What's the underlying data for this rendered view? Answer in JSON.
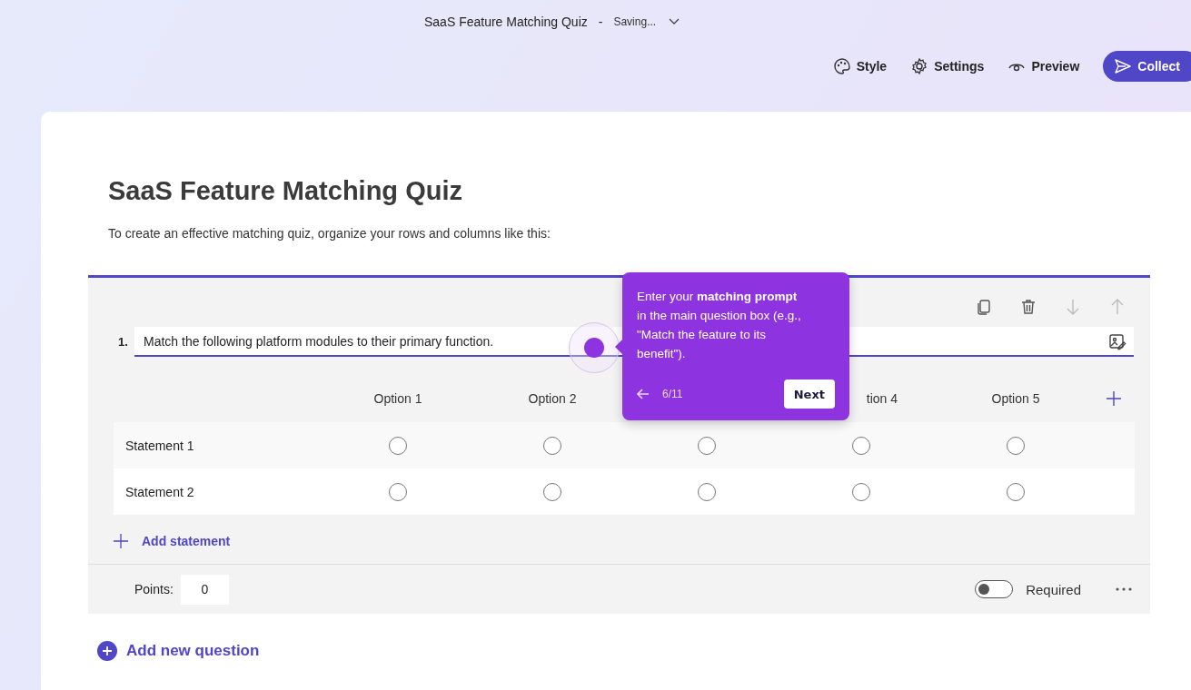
{
  "header": {
    "title": "SaaS Feature Matching Quiz",
    "separator": "-",
    "status": "Saving...",
    "actions": [
      {
        "kind": "style",
        "label": "Style"
      },
      {
        "kind": "settings",
        "label": "Settings"
      },
      {
        "kind": "preview",
        "label": "Preview"
      }
    ],
    "primary": "Collect"
  },
  "form": {
    "title": "SaaS Feature Matching Quiz",
    "description": "To create an effective matching quiz, organize your rows and columns like this:"
  },
  "question": {
    "number": "1.",
    "text": "Match the following platform modules to their primary function.",
    "toolbar": [
      {
        "kind": "copy",
        "disabled": false
      },
      {
        "kind": "delete",
        "disabled": false
      },
      {
        "kind": "down",
        "disabled": true
      },
      {
        "kind": "up",
        "disabled": true
      }
    ],
    "columns": [
      {
        "kind": "label",
        "label": "Option 1"
      },
      {
        "kind": "label",
        "label": "Option 2"
      },
      {
        "kind": "covered"
      },
      {
        "kind": "cut",
        "label": "tion 4"
      },
      {
        "kind": "label",
        "label": "Option 5"
      }
    ],
    "rows": [
      {
        "label": "Statement 1",
        "choices": [
          {
            "selected": false
          },
          {
            "selected": false
          },
          {
            "selected": false
          },
          {
            "selected": false
          },
          {
            "selected": false
          }
        ]
      },
      {
        "label": "Statement 2",
        "choices": [
          {
            "selected": false
          },
          {
            "selected": false
          },
          {
            "selected": false
          },
          {
            "selected": false
          },
          {
            "selected": false
          }
        ]
      }
    ],
    "add_statement": "Add statement",
    "points_label": "Points:",
    "points": "0",
    "required": {
      "label": "Required",
      "on": false
    }
  },
  "add_question": "Add new question",
  "tooltip": {
    "parts": [
      "Enter your **matching prompt** in the main question box (e.g., \"Match the feature to its benefit\")."
    ],
    "step": "6/11",
    "next": "Next"
  }
}
